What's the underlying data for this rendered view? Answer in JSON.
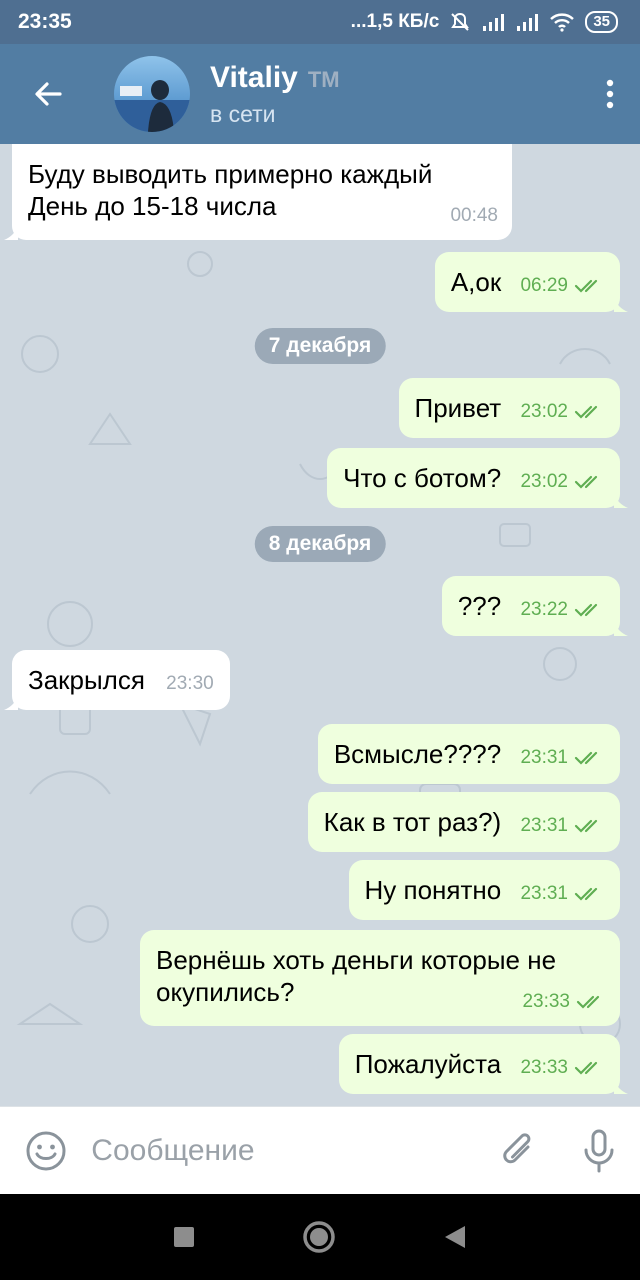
{
  "status_bar": {
    "time": "23:35",
    "network_speed": "...1,5 КБ/с",
    "battery": "35"
  },
  "header": {
    "contact_name": "Vitaliy",
    "contact_badge": "TM",
    "contact_status": "в сети",
    "icons": [
      "back-arrow-icon",
      "avatar",
      "more-vert-icon"
    ]
  },
  "chat": {
    "messages": [
      {
        "dir": "in",
        "text_line1": "Буду выводить примерно каждый",
        "text_line2": "День до 15-18 числа",
        "time": "00:48"
      },
      {
        "dir": "out",
        "text": "А,ок",
        "time": "06:29"
      },
      {
        "type": "date",
        "text": "7 декабря"
      },
      {
        "dir": "out",
        "text": "Привет",
        "time": "23:02"
      },
      {
        "dir": "out",
        "text": "Что с ботом?",
        "time": "23:02"
      },
      {
        "type": "date",
        "text": "8 декабря"
      },
      {
        "dir": "out",
        "text": "???",
        "time": "23:22"
      },
      {
        "dir": "in",
        "text": "Закрылся",
        "time": "23:30"
      },
      {
        "dir": "out",
        "text": "Всмысле????",
        "time": "23:31"
      },
      {
        "dir": "out",
        "text": "Как в тот раз?)",
        "time": "23:31"
      },
      {
        "dir": "out",
        "text": "Ну понятно",
        "time": "23:31"
      },
      {
        "dir": "out",
        "text_line1": "Вернёшь хоть деньги которые не",
        "text_line2": "окупились?",
        "time": "23:33"
      },
      {
        "dir": "out",
        "text": "Пожалуйста",
        "time": "23:33"
      }
    ]
  },
  "input": {
    "placeholder": "Сообщение"
  },
  "colors": {
    "header": "#527da3",
    "status_bar": "#4f6f91",
    "chat_bg": "#cfd8e0",
    "out_bubble": "#efffde",
    "check_green": "#5fae52"
  }
}
